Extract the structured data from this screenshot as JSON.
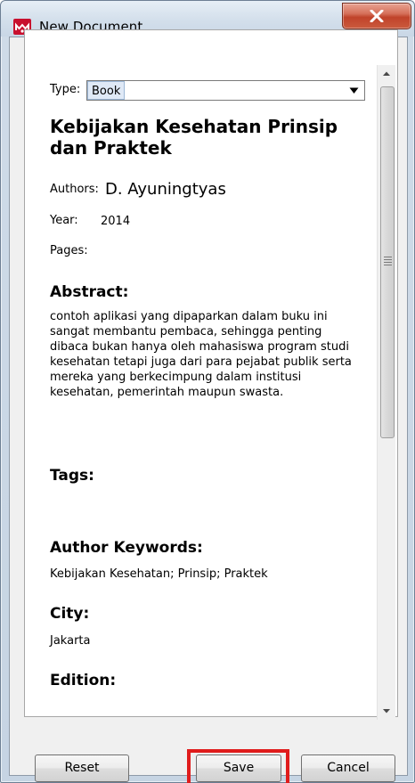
{
  "window": {
    "title": "New Document",
    "close_label": "X"
  },
  "form": {
    "type_label": "Type:",
    "type_value": "Book",
    "title": "Kebijakan Kesehatan Prinsip dan Praktek",
    "authors_label": "Authors:",
    "authors_value": "D. Ayuningtyas",
    "year_label": "Year:",
    "year_value": "2014",
    "pages_label": "Pages:",
    "pages_value": "",
    "abstract_label": "Abstract:",
    "abstract_value": "contoh aplikasi yang dipaparkan dalam buku ini sangat membantu pembaca, sehingga penting dibaca bukan hanya oleh mahasiswa program studi kesehatan tetapi juga dari para pejabat publik serta mereka yang berkecimpung dalam institusi kesehatan, pemerintah maupun swasta.",
    "tags_label": "Tags:",
    "tags_value": "",
    "author_keywords_label": "Author Keywords:",
    "author_keywords_value": "Kebijakan Kesehatan; Prinsip; Praktek",
    "city_label": "City:",
    "city_value": "Jakarta",
    "edition_label": "Edition:"
  },
  "buttons": {
    "reset": "Reset",
    "save": "Save",
    "cancel": "Cancel"
  },
  "colors": {
    "highlight": "#e01c1c",
    "app_icon": "#c8102e",
    "close_button": "#c0432a"
  }
}
